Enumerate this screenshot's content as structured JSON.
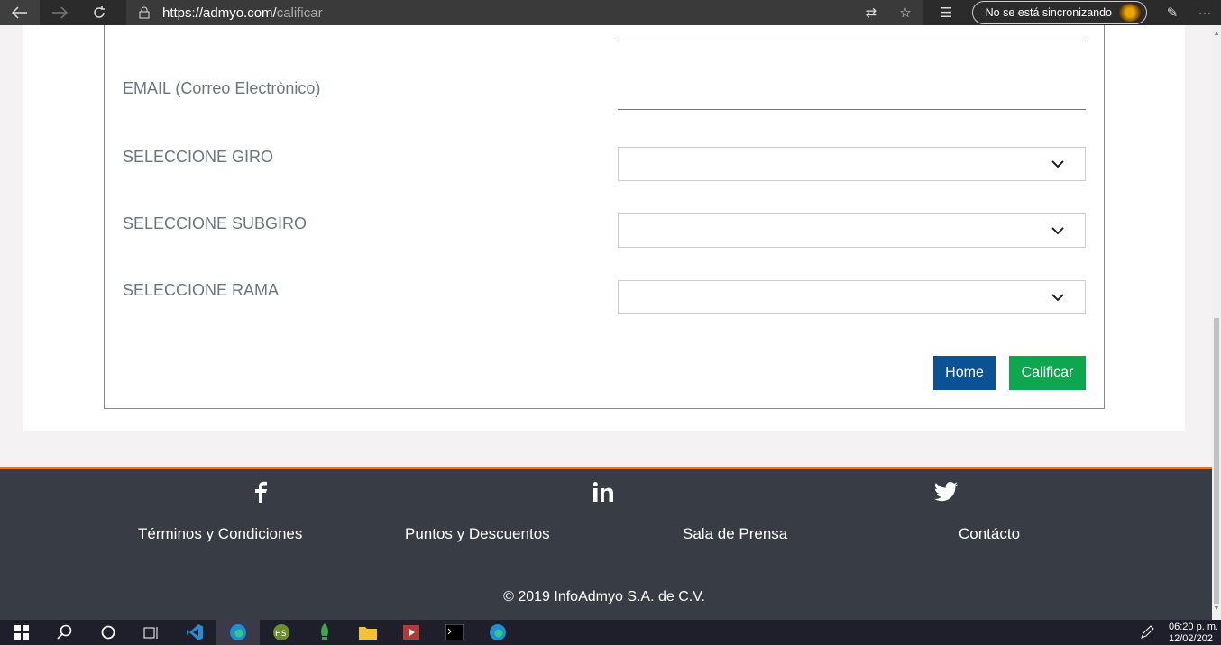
{
  "browser": {
    "url_host": "https://admyo.com/",
    "url_path": "calificar",
    "sync_label": "No se está sincronizando"
  },
  "form": {
    "email_label": "EMAIL (Correo Electrònico)",
    "giro_label": "SELECCIONE GIRO",
    "subgiro_label": "SELECCIONE SUBGIRO",
    "rama_label": "SELECCIONE RAMA",
    "giro_value": "",
    "subgiro_value": "",
    "rama_value": "",
    "home_button": "Home",
    "calificar_button": "Calificar"
  },
  "footer": {
    "links": [
      "Términos y Condiciones",
      "Puntos y Descuentos",
      "Sala de Prensa",
      "Contácto"
    ],
    "copyright": "© 2019 InfoAdmyo S.A. de C.V.",
    "accent_color": "#e8752a"
  },
  "taskbar": {
    "time": "06:20 p. m.",
    "date": "12/02/202"
  },
  "colors": {
    "home_button": "#0a5294",
    "calificar_button": "#0fa650",
    "footer_bg": "#383c44"
  }
}
